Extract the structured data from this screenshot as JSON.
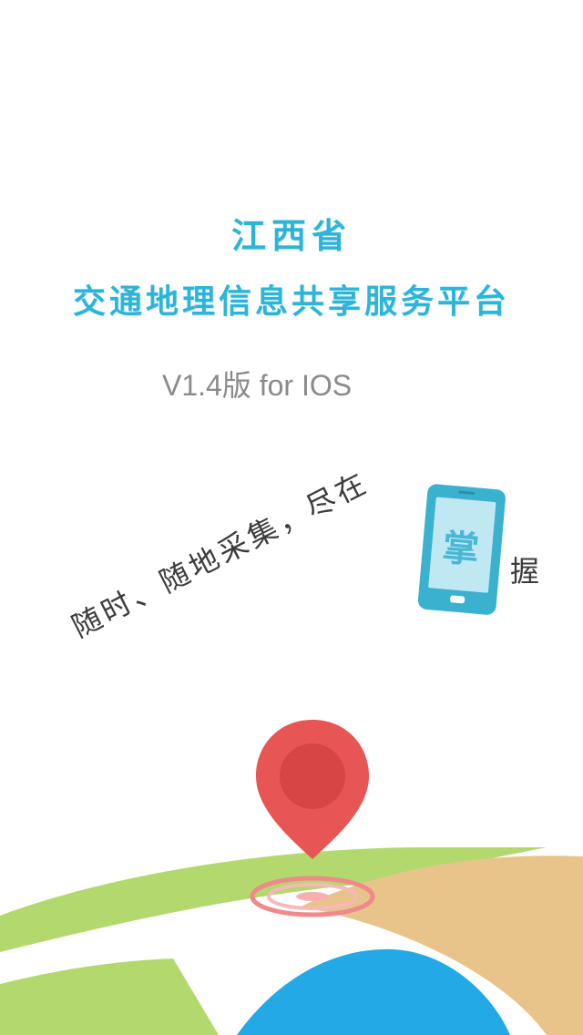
{
  "title": {
    "line1": "江西省",
    "line2": "交通地理信息共享服务平台"
  },
  "version": "V1.4版 for IOS",
  "slogan": {
    "text": "随时、随地采集，尽在",
    "phone_char": "掌",
    "last_char": "握"
  },
  "colors": {
    "accent": "#29b6d8",
    "pin_red": "#e85555",
    "land_green": "#b3d86e",
    "land_orange": "#e8c48a",
    "sea_blue": "#22a9e6"
  },
  "icons": {
    "phone": "smartphone-icon",
    "pin": "location-pin-icon"
  }
}
